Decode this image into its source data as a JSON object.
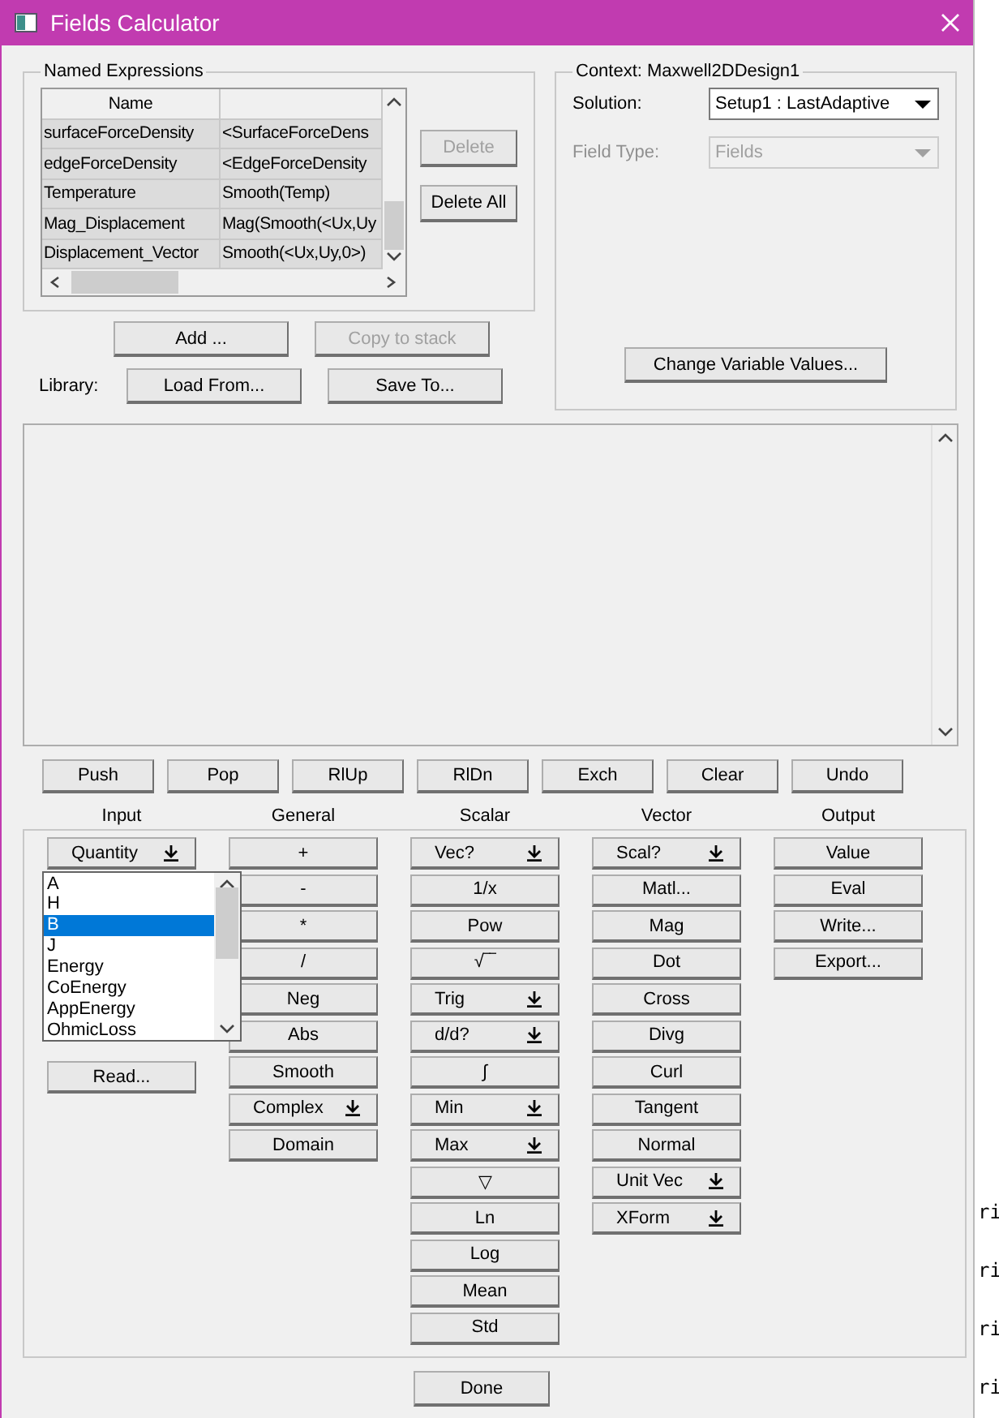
{
  "window": {
    "title": "Fields Calculator"
  },
  "named_expressions": {
    "title": "Named Expressions",
    "columns": [
      "Name"
    ],
    "rows": [
      {
        "name": "surfaceForceDensity",
        "value": "<SurfaceForceDens"
      },
      {
        "name": "edgeForceDensity",
        "value": "<EdgeForceDensity"
      },
      {
        "name": "Temperature",
        "value": "Smooth(Temp)"
      },
      {
        "name": "Mag_Displacement",
        "value": "Mag(Smooth(<Ux,Uy"
      },
      {
        "name": "Displacement_Vector",
        "value": "Smooth(<Ux,Uy,0>)"
      }
    ],
    "buttons": [
      {
        "label": "Delete",
        "disabled": true
      },
      {
        "label": "Delete All",
        "disabled": false
      }
    ]
  },
  "expression_buttons": [
    {
      "label": "Add ...",
      "disabled": false
    },
    {
      "label": "Copy to stack",
      "disabled": true
    }
  ],
  "library": {
    "label": "Library:",
    "buttons": [
      {
        "label": "Load From...",
        "disabled": false
      },
      {
        "label": "Save To...",
        "disabled": false
      }
    ]
  },
  "context": {
    "title": "Context: Maxwell2DDesign1",
    "solution_label": "Solution:",
    "solution": "Setup1 : LastAdaptive",
    "solution_disabled": false,
    "field_type_label": "Field Type:",
    "field_type": "Fields",
    "field_type_disabled": true,
    "button": "Change Variable Values..."
  },
  "stack_buttons": [
    "Push",
    "Pop",
    "RlUp",
    "RlDn",
    "Exch",
    "Clear",
    "Undo"
  ],
  "columns": [
    {
      "title": "Input",
      "buttons": [
        {
          "label": "Quantity",
          "kind": "menu"
        },
        {
          "label": "Read...",
          "kind": "plain"
        }
      ],
      "open_menu": [
        {
          "label": "A",
          "selected": false
        },
        {
          "label": "H",
          "selected": false
        },
        {
          "label": "B",
          "selected": true
        },
        {
          "label": "J",
          "selected": false
        },
        {
          "label": "Energy",
          "selected": false
        },
        {
          "label": "CoEnergy",
          "selected": false
        },
        {
          "label": "AppEnergy",
          "selected": false
        },
        {
          "label": "OhmicLoss",
          "selected": false
        }
      ]
    },
    {
      "title": "General",
      "buttons": [
        {
          "label": "+",
          "kind": "plain"
        },
        {
          "label": "-",
          "kind": "plain"
        },
        {
          "label": "*",
          "kind": "plain"
        },
        {
          "label": "/",
          "kind": "plain"
        },
        {
          "label": "Neg",
          "kind": "plain"
        },
        {
          "label": "Abs",
          "kind": "plain"
        },
        {
          "label": "Smooth",
          "kind": "plain"
        },
        {
          "label": "Complex",
          "kind": "menu"
        },
        {
          "label": "Domain",
          "kind": "plain"
        }
      ]
    },
    {
      "title": "Scalar",
      "buttons": [
        {
          "label": "Vec?",
          "kind": "menu"
        },
        {
          "label": "1/x",
          "kind": "plain"
        },
        {
          "label": "Pow",
          "kind": "plain"
        },
        {
          "label": "√‾‾",
          "kind": "plain"
        },
        {
          "label": "Trig",
          "kind": "menu"
        },
        {
          "label": "d/d?",
          "kind": "menu"
        },
        {
          "label": "∫",
          "kind": "plain"
        },
        {
          "label": "Min",
          "kind": "menu"
        },
        {
          "label": "Max",
          "kind": "menu"
        },
        {
          "label": "▽",
          "kind": "plain"
        },
        {
          "label": "Ln",
          "kind": "plain"
        },
        {
          "label": "Log",
          "kind": "plain"
        },
        {
          "label": "Mean",
          "kind": "plain"
        },
        {
          "label": "Std",
          "kind": "plain"
        }
      ]
    },
    {
      "title": "Vector",
      "buttons": [
        {
          "label": "Scal?",
          "kind": "menu"
        },
        {
          "label": "Matl...",
          "kind": "plain"
        },
        {
          "label": "Mag",
          "kind": "plain"
        },
        {
          "label": "Dot",
          "kind": "plain"
        },
        {
          "label": "Cross",
          "kind": "plain"
        },
        {
          "label": "Divg",
          "kind": "plain"
        },
        {
          "label": "Curl",
          "kind": "plain"
        },
        {
          "label": "Tangent",
          "kind": "plain"
        },
        {
          "label": "Normal",
          "kind": "plain"
        },
        {
          "label": "Unit Vec",
          "kind": "menu"
        },
        {
          "label": "XForm",
          "kind": "menu"
        }
      ]
    },
    {
      "title": "Output",
      "buttons": [
        {
          "label": "Value",
          "kind": "plain"
        },
        {
          "label": "Eval",
          "kind": "plain"
        },
        {
          "label": "Write...",
          "kind": "plain"
        },
        {
          "label": "Export...",
          "kind": "plain"
        }
      ]
    }
  ],
  "done": "Done",
  "background_window": {
    "lines": [
      "ri",
      "ri",
      "ri",
      "ri"
    ]
  }
}
